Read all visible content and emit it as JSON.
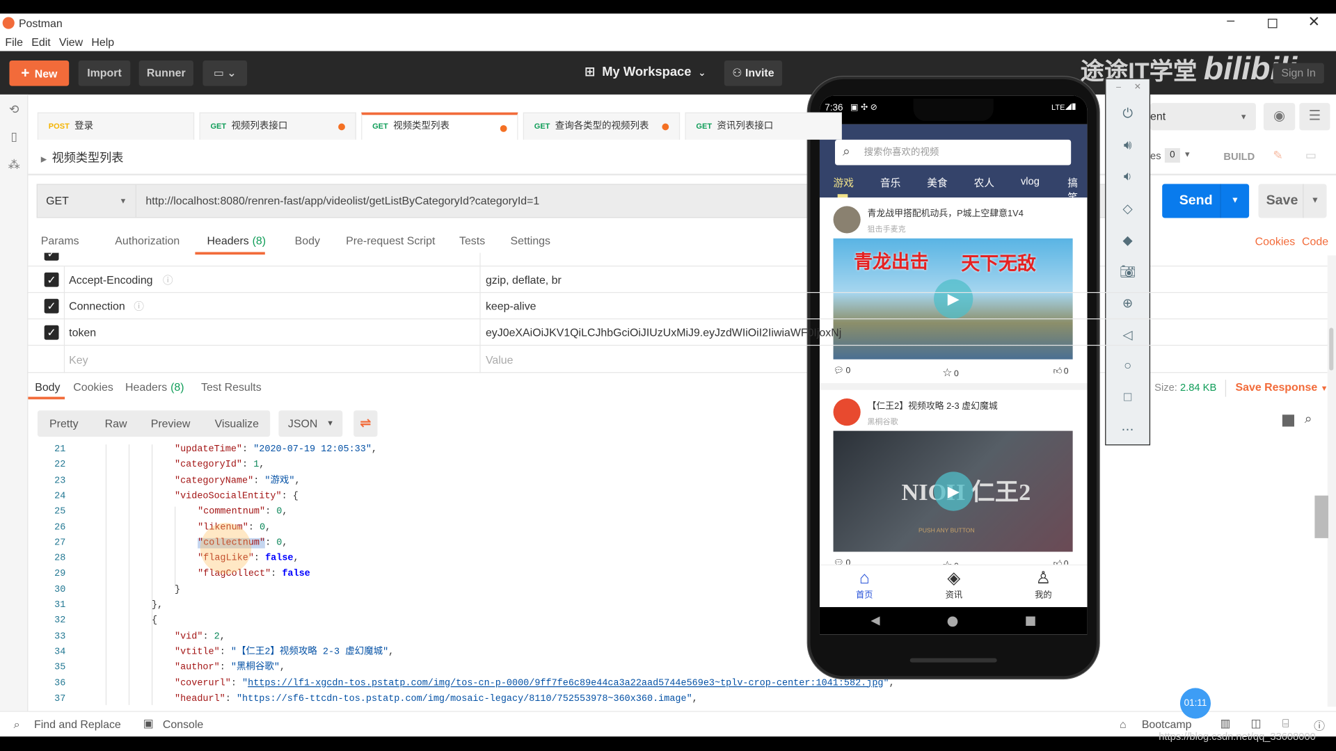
{
  "window": {
    "title": "Postman",
    "controls": [
      "minimize-icon",
      "restore-icon",
      "close-icon"
    ]
  },
  "menu": [
    "File",
    "Edit",
    "View",
    "Help"
  ],
  "header": {
    "new": "New",
    "import": "Import",
    "runner": "Runner",
    "workspace": "My Workspace",
    "invite": "Invite",
    "watermark": "途途IT学堂 bilibili",
    "sign_in": "Sign In"
  },
  "colors": {
    "accent": "#f26b3a",
    "send": "#097bed",
    "get": "#0f9d58",
    "post": "#f4b400",
    "phone_header": "#34436a"
  },
  "tabs": [
    {
      "method": "POST",
      "name": "登录",
      "dirty": false
    },
    {
      "method": "GET",
      "name": "视频列表接口",
      "dirty": true
    },
    {
      "method": "GET",
      "name": "视频类型列表",
      "dirty": true,
      "active": true
    },
    {
      "method": "GET",
      "name": "查询各类型的视频列表",
      "dirty": true
    },
    {
      "method": "GET",
      "name": "资讯列表接口",
      "dirty": false
    }
  ],
  "request": {
    "name": "视频类型列表",
    "method": "GET",
    "url": "http://localhost:8080/renren-fast/app/videolist/getListByCategoryId?categoryId=1",
    "environment": "ent",
    "examples_label": "es",
    "examples_count": "0",
    "build": "BUILD",
    "send": "Send",
    "save": "Save",
    "cookies": "Cookies",
    "code": "Code"
  },
  "request_tabs": [
    {
      "label": "Params",
      "badge_dot": true
    },
    {
      "label": "Authorization"
    },
    {
      "label": "Headers",
      "count": "(8)",
      "active": true
    },
    {
      "label": "Body"
    },
    {
      "label": "Pre-request Script"
    },
    {
      "label": "Tests"
    },
    {
      "label": "Settings"
    }
  ],
  "headers": [
    {
      "key": "Accept-Encoding",
      "value": "gzip, deflate, br",
      "checked": true,
      "info": true
    },
    {
      "key": "Connection",
      "value": "keep-alive",
      "checked": true,
      "info": true
    },
    {
      "key": "token",
      "value": "eyJ0eXAiOiJKV1QiLCJhbGciOiJIUzUxMiJ9.eyJzdWIiOiI2IiwiaWF0IjoxNj",
      "checked": true
    }
  ],
  "headers_placeholder": {
    "key": "Key",
    "value": "Value"
  },
  "response": {
    "tabs": [
      {
        "label": "Body",
        "active": true
      },
      {
        "label": "Cookies"
      },
      {
        "label": "Headers",
        "count": "(8)"
      },
      {
        "label": "Test Results"
      }
    ],
    "size_label": "Size:",
    "size": "2.84 KB",
    "save_response": "Save Response",
    "views": [
      "Pretty",
      "Raw",
      "Preview",
      "Visualize"
    ],
    "format": "JSON"
  },
  "code_lines": [
    {
      "n": "21",
      "i": 3,
      "t": [
        [
          "k",
          "\"updateTime\""
        ],
        [
          "p",
          ": "
        ],
        [
          "s",
          "\"2020-07-19 12:05:33\""
        ],
        [
          "p",
          ","
        ]
      ]
    },
    {
      "n": "22",
      "i": 3,
      "t": [
        [
          "k",
          "\"categoryId\""
        ],
        [
          "p",
          ": "
        ],
        [
          "n",
          "1"
        ],
        [
          "p",
          ","
        ]
      ]
    },
    {
      "n": "23",
      "i": 3,
      "t": [
        [
          "k",
          "\"categoryName\""
        ],
        [
          "p",
          ": "
        ],
        [
          "s",
          "\"游戏\""
        ],
        [
          "p",
          ","
        ]
      ]
    },
    {
      "n": "24",
      "i": 3,
      "t": [
        [
          "k",
          "\"videoSocialEntity\""
        ],
        [
          "p",
          ": {"
        ]
      ]
    },
    {
      "n": "25",
      "i": 4,
      "t": [
        [
          "k",
          "\"commentnum\""
        ],
        [
          "p",
          ": "
        ],
        [
          "n",
          "0"
        ],
        [
          "p",
          ","
        ]
      ]
    },
    {
      "n": "26",
      "i": 4,
      "t": [
        [
          "k",
          "\"likenum\""
        ],
        [
          "p",
          ": "
        ],
        [
          "n",
          "0"
        ],
        [
          "p",
          ","
        ]
      ]
    },
    {
      "n": "27",
      "i": 4,
      "t": [
        [
          "k",
          "\"collectnum\""
        ],
        [
          "p",
          ": "
        ],
        [
          "n",
          "0"
        ],
        [
          "p",
          ","
        ]
      ]
    },
    {
      "n": "28",
      "i": 4,
      "t": [
        [
          "k",
          "\"flagLike\""
        ],
        [
          "p",
          ": "
        ],
        [
          "b",
          "false"
        ],
        [
          "p",
          ","
        ]
      ]
    },
    {
      "n": "29",
      "i": 4,
      "t": [
        [
          "k",
          "\"flagCollect\""
        ],
        [
          "p",
          ": "
        ],
        [
          "b",
          "false"
        ]
      ]
    },
    {
      "n": "30",
      "i": 3,
      "t": [
        [
          "p",
          "}"
        ]
      ]
    },
    {
      "n": "31",
      "i": 2,
      "t": [
        [
          "p",
          "},"
        ]
      ]
    },
    {
      "n": "32",
      "i": 2,
      "t": [
        [
          "p",
          "{"
        ]
      ]
    },
    {
      "n": "33",
      "i": 3,
      "t": [
        [
          "k",
          "\"vid\""
        ],
        [
          "p",
          ": "
        ],
        [
          "n",
          "2"
        ],
        [
          "p",
          ","
        ]
      ]
    },
    {
      "n": "34",
      "i": 3,
      "t": [
        [
          "k",
          "\"vtitle\""
        ],
        [
          "p",
          ": "
        ],
        [
          "s",
          "\"【仁王2】视频攻略 2-3 虚幻魔城\""
        ],
        [
          "p",
          ","
        ]
      ]
    },
    {
      "n": "35",
      "i": 3,
      "t": [
        [
          "k",
          "\"author\""
        ],
        [
          "p",
          ": "
        ],
        [
          "s",
          "\"黑桐谷歌\""
        ],
        [
          "p",
          ","
        ]
      ]
    },
    {
      "n": "36",
      "i": 3,
      "t": [
        [
          "k",
          "\"coverurl\""
        ],
        [
          "p",
          ": "
        ],
        [
          "s",
          "\""
        ],
        [
          "u",
          "https://lf1-xgcdn-tos.pstatp.com/img/tos-cn-p-0000/9ff7fe6c89e44ca3a22aad5744e569e3~tplv-crop-center:1041:582.jpg"
        ],
        [
          "s",
          "\""
        ],
        [
          "p",
          ","
        ]
      ]
    },
    {
      "n": "37",
      "i": 3,
      "t": [
        [
          "k",
          "\"headurl\""
        ],
        [
          "p",
          ": "
        ],
        [
          "s",
          "\"https://sf6-ttcdn-tos.pstatp.com/img/mosaic-legacy/8110/752553978~360x360.image\""
        ],
        [
          "p",
          ","
        ]
      ]
    }
  ],
  "status_bar": {
    "find_replace": "Find and Replace",
    "console": "Console",
    "bootcamp": "Bootcamp",
    "timer": "01:11",
    "url_overlay": "https://blog.csdn.net/qq_33608000"
  },
  "phone": {
    "time": "7:36",
    "network": "LTE",
    "search_placeholder": "搜索你喜欢的视频",
    "categories": [
      {
        "label": "游戏",
        "active": true
      },
      {
        "label": "音乐"
      },
      {
        "label": "美食"
      },
      {
        "label": "农人"
      },
      {
        "label": "vlog"
      },
      {
        "label": "搞笑"
      }
    ],
    "videos": [
      {
        "title": "青龙战甲搭配机动兵，P城上空肆意1V4",
        "author": "狙击手麦克",
        "cover_text_left": "青龙出击",
        "cover_text_right": "天下无敌",
        "comments": "0",
        "collects": "0",
        "likes": "0"
      },
      {
        "title": "【仁王2】视频攻略 2-3 虚幻魔城",
        "author": "黑桐谷歌",
        "cover_text": "NIOH 仁王2",
        "cover_sub": "PUSH ANY BUTTON",
        "comments": "0",
        "collects": "0",
        "likes": "0"
      }
    ],
    "nav": [
      {
        "label": "首页",
        "icon": "home-icon",
        "active": true
      },
      {
        "label": "资讯",
        "icon": "compass-icon"
      },
      {
        "label": "我的",
        "icon": "user-icon"
      }
    ]
  },
  "emulator_toolbar": [
    "power-icon",
    "volume-up-icon",
    "volume-down-icon",
    "rotate-left-icon",
    "rotate-right-icon",
    "camera-icon",
    "zoom-icon",
    "back-icon",
    "home-icon",
    "overview-icon",
    "more-icon"
  ]
}
